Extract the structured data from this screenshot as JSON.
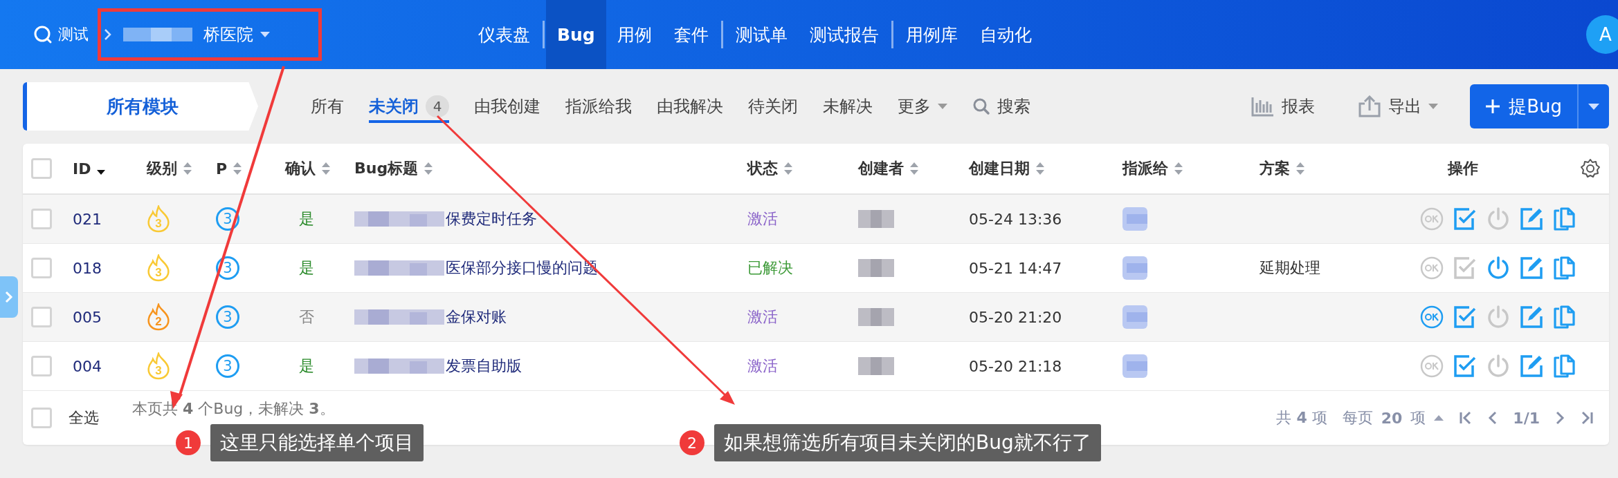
{
  "top_bar": {
    "search_label": "测试",
    "breadcrumb": "桥医院",
    "nav": [
      {
        "label": "仪表盘",
        "selected": false,
        "divider_before": false
      },
      {
        "label": "Bug",
        "selected": true,
        "divider_before": true
      },
      {
        "label": "用例",
        "selected": false,
        "divider_before": false
      },
      {
        "label": "套件",
        "selected": false,
        "divider_before": false
      },
      {
        "label": "测试单",
        "selected": false,
        "divider_before": true
      },
      {
        "label": "测试报告",
        "selected": false,
        "divider_before": false
      },
      {
        "label": "用例库",
        "selected": false,
        "divider_before": true
      },
      {
        "label": "自动化",
        "selected": false,
        "divider_before": false
      }
    ],
    "avatar": "A"
  },
  "toolbar": {
    "module_button": "所有模块",
    "filters": [
      {
        "label": "所有",
        "selected": false
      },
      {
        "label": "未关闭",
        "selected": true,
        "count": "4"
      },
      {
        "label": "由我创建",
        "selected": false
      },
      {
        "label": "指派给我",
        "selected": false
      },
      {
        "label": "由我解决",
        "selected": false
      },
      {
        "label": "待关闭",
        "selected": false
      },
      {
        "label": "未解决",
        "selected": false
      }
    ],
    "more": "更多",
    "search": "搜索",
    "report": "报表",
    "export": "导出",
    "create": "提Bug"
  },
  "table": {
    "columns": [
      {
        "label": "ID",
        "sort_desc": true
      },
      {
        "label": "级别",
        "sort_desc": false
      },
      {
        "label": "P",
        "sort_desc": false
      },
      {
        "label": "确认",
        "sort_desc": false
      },
      {
        "label": "Bug标题",
        "sort_desc": false
      },
      {
        "label": "状态",
        "sort_desc": false
      },
      {
        "label": "创建者",
        "sort_desc": false
      },
      {
        "label": "创建日期",
        "sort_desc": false
      },
      {
        "label": "指派给",
        "sort_desc": false
      },
      {
        "label": "方案",
        "sort_desc": false
      },
      {
        "label": "操作"
      }
    ],
    "header_checked": false,
    "rows": [
      {
        "checked": false,
        "id": "021",
        "severity": "3",
        "color": "#f9c934",
        "priority": "3",
        "confirmed": true,
        "confirm_text": "是",
        "title": "保费定时任务",
        "status": {
          "label": "激活",
          "color": "#8a63c9"
        },
        "date": "05-24 13:36",
        "resolution": "",
        "actions": {
          "ok": false,
          "confirm": true,
          "close": false,
          "edit": true,
          "copy": true
        }
      },
      {
        "checked": false,
        "id": "018",
        "severity": "3",
        "color": "#f9c934",
        "priority": "3",
        "confirmed": true,
        "confirm_text": "是",
        "title": "医保部分接口慢的问题",
        "status": {
          "label": "已解决",
          "color": "#3c9a37"
        },
        "date": "05-21 14:47",
        "resolution": "延期处理",
        "actions": {
          "ok": false,
          "confirm": false,
          "close": true,
          "edit": true,
          "copy": true
        }
      },
      {
        "checked": false,
        "id": "005",
        "severity": "2",
        "color": "#f7941d",
        "priority": "3",
        "confirmed": false,
        "confirm_text": "否",
        "title": "金保对账",
        "status": {
          "label": "激活",
          "color": "#8a63c9"
        },
        "date": "05-20 21:20",
        "resolution": "",
        "actions": {
          "ok": true,
          "confirm": true,
          "close": false,
          "edit": true,
          "copy": true
        }
      },
      {
        "checked": false,
        "id": "004",
        "severity": "3",
        "color": "#f9c934",
        "priority": "3",
        "confirmed": true,
        "confirm_text": "是",
        "title": "发票自助版",
        "status": {
          "label": "激活",
          "color": "#8a63c9"
        },
        "date": "05-20 21:18",
        "resolution": "",
        "actions": {
          "ok": false,
          "confirm": true,
          "close": false,
          "edit": true,
          "copy": true
        }
      }
    ]
  },
  "footer": {
    "select_all": "全选",
    "select_all_checked": false,
    "summary": "本页共 **4** 个Bug，未解决 **3**。",
    "total": "共 **4** 项",
    "per_page": "每页 **20** 项",
    "page": "1/1"
  },
  "annotations": [
    {
      "number": "1",
      "text": "这里只能选择单个项目"
    },
    {
      "number": "2",
      "text": "如果想筛选所有项目未关闭的Bug就不行了"
    }
  ]
}
